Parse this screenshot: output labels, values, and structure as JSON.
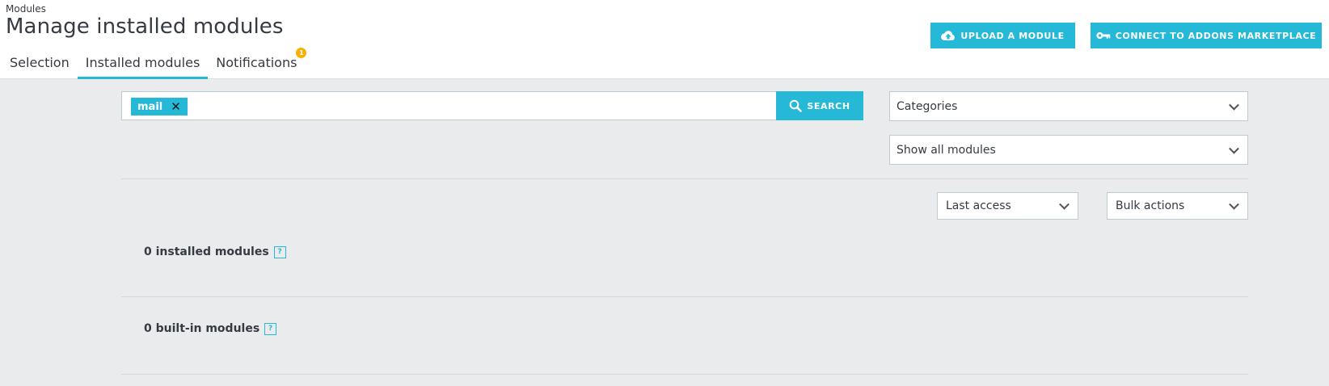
{
  "header": {
    "breadcrumb": "Modules",
    "title": "Manage installed modules",
    "tabs": [
      {
        "label": "Selection"
      },
      {
        "label": "Installed modules"
      },
      {
        "label": "Notifications",
        "badge": "1"
      }
    ],
    "upload_button": "Upload a module",
    "connect_button": "Connect to Addons marketplace"
  },
  "search": {
    "tag": "mail",
    "button_label": "Search"
  },
  "filters": {
    "categories": "Categories",
    "status": "Show all modules",
    "sort": "Last access",
    "bulk": "Bulk actions"
  },
  "sections": {
    "installed": "0 installed modules",
    "builtin": "0 built-in modules",
    "help_glyph": "?"
  },
  "colors": {
    "accent": "#25b9d7",
    "badge": "#fab000",
    "background": "#eaebec"
  }
}
